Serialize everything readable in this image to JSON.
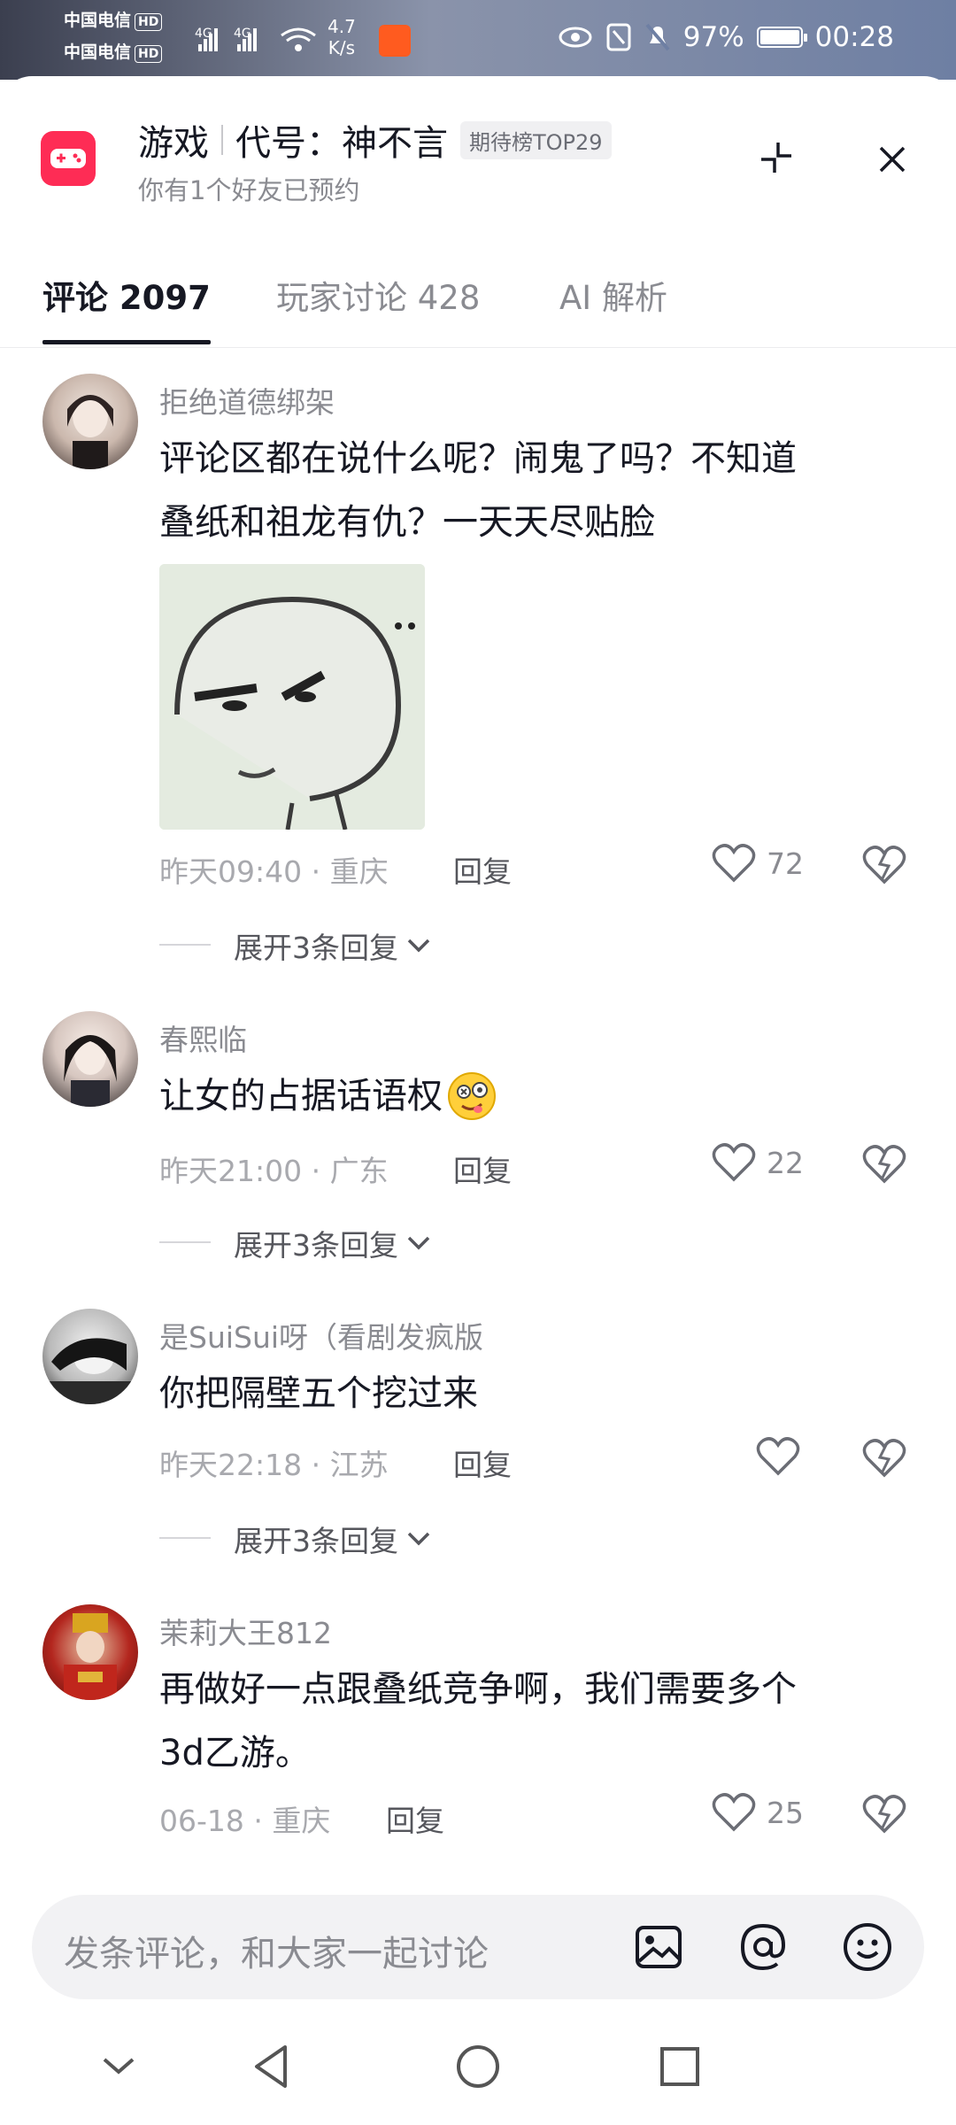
{
  "status_bar": {
    "carrier1": "中国电信",
    "carrier2": "中国电信",
    "hd": "HD",
    "net": "4G",
    "speed": "4.7",
    "speed_unit": "K/s",
    "battery": "97%",
    "time": "00:28"
  },
  "header": {
    "category": "游戏",
    "title": "代号：神不言",
    "badge": "期待榜TOP29",
    "subtitle": "你有1个好友已预约"
  },
  "tabs": [
    {
      "label": "评论 2097",
      "active": true
    },
    {
      "label": "玩家讨论 428",
      "active": false
    },
    {
      "label": "AI 解析",
      "active": false
    }
  ],
  "comments": [
    {
      "username": "拒绝道德绑架",
      "content_line1": "评论区都在说什么呢？闹鬼了吗？不知道",
      "content_line2": "叠纸和祖龙有仇？一天天尽贴脸",
      "time": "昨天09:40 · 重庆",
      "reply": "回复",
      "likes": "72",
      "expand": "展开3条回复"
    },
    {
      "username": "春熙临",
      "content_line1": "让女的占据话语权",
      "time": "昨天21:00 · 广东",
      "reply": "回复",
      "likes": "22",
      "expand": "展开3条回复"
    },
    {
      "username": "是SuiSui呀（看剧发疯版",
      "content_line1": "你把隔壁五个挖过来",
      "time": "昨天22:18 · 江苏",
      "reply": "回复",
      "likes": "",
      "expand": "展开3条回复"
    },
    {
      "username": "茉莉大王812",
      "content_line1": "再做好一点跟叠纸竞争啊，我们需要多个",
      "content_line2": "3d乙游。",
      "time": "06-18 · 重庆",
      "reply": "回复",
      "likes": "25"
    }
  ],
  "input": {
    "placeholder": "发条评论，和大家一起讨论"
  },
  "colors": {
    "accent": "#fe2c55",
    "text_primary": "#161823",
    "text_secondary": "#8a8b91"
  }
}
